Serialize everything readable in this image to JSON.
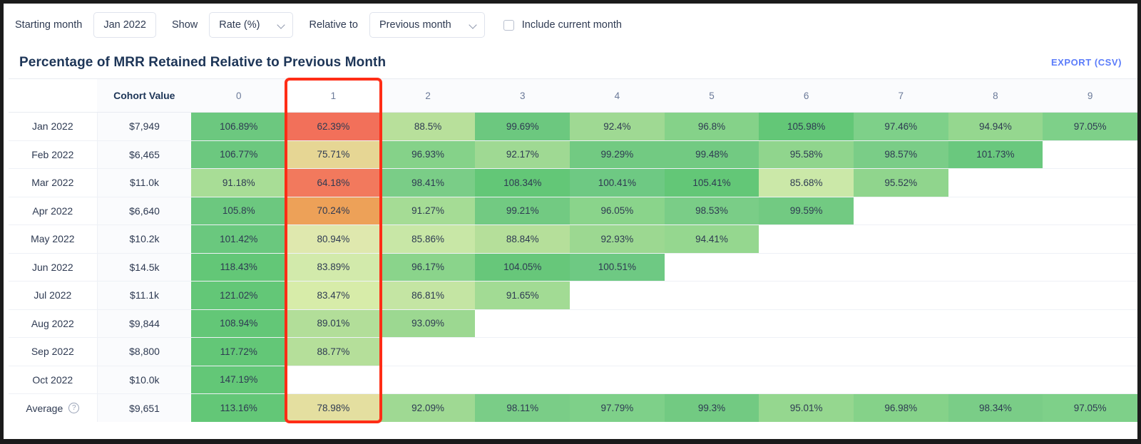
{
  "toolbar": {
    "starting_month_label": "Starting month",
    "starting_month_value": "Jan 2022",
    "show_label": "Show",
    "show_value": "Rate (%)",
    "relative_to_label": "Relative to",
    "relative_to_value": "Previous month",
    "include_current_month_label": "Include current month",
    "include_current_month_checked": false
  },
  "header": {
    "title": "Percentage of MRR Retained Relative to Previous Month",
    "export_label": "EXPORT (CSV)"
  },
  "colors": {
    "accent_link": "#5b7cfa",
    "title": "#1d3557",
    "highlight_box": "#ff2d16",
    "green_dark": "#63c777",
    "green_mid": "#7fd18b",
    "green_light": "#a8dd95",
    "green_pale": "#cbe8a8",
    "yellow": "#e4dfa0",
    "orange": "#eda158",
    "red": "#f2705a"
  },
  "table": {
    "label_header": "",
    "cohort_value_header": "Cohort Value",
    "period_headers": [
      "0",
      "1",
      "2",
      "3",
      "4",
      "5",
      "6",
      "7",
      "8",
      "9"
    ],
    "highlighted_column_index": 1,
    "average_row_label": "Average",
    "average_help_icon": "question-circle-icon",
    "rows": [
      {
        "label": "Jan 2022",
        "cohort_value": "$7,949",
        "cells": [
          {
            "text": "106.89%",
            "color": "#6cc87f"
          },
          {
            "text": "62.39%",
            "color": "#f2705a"
          },
          {
            "text": "88.5%",
            "color": "#b8e09b"
          },
          {
            "text": "99.69%",
            "color": "#6cc87f"
          },
          {
            "text": "92.4%",
            "color": "#9fd993"
          },
          {
            "text": "96.8%",
            "color": "#85d289"
          },
          {
            "text": "105.98%",
            "color": "#63c777"
          },
          {
            "text": "97.46%",
            "color": "#7ed089"
          },
          {
            "text": "94.94%",
            "color": "#95d78f"
          },
          {
            "text": "97.05%",
            "color": "#7ed089"
          }
        ]
      },
      {
        "label": "Feb 2022",
        "cohort_value": "$6,465",
        "cells": [
          {
            "text": "106.77%",
            "color": "#6cc87f"
          },
          {
            "text": "75.71%",
            "color": "#e6d694"
          },
          {
            "text": "96.93%",
            "color": "#85d289"
          },
          {
            "text": "92.17%",
            "color": "#9fd993"
          },
          {
            "text": "99.29%",
            "color": "#72ca82"
          },
          {
            "text": "99.48%",
            "color": "#72ca82"
          },
          {
            "text": "95.58%",
            "color": "#90d58d"
          },
          {
            "text": "98.57%",
            "color": "#7acd87"
          },
          {
            "text": "101.73%",
            "color": "#6ac87e"
          }
        ]
      },
      {
        "label": "Mar 2022",
        "cohort_value": "$11.0k",
        "cells": [
          {
            "text": "91.18%",
            "color": "#a8dd96"
          },
          {
            "text": "64.18%",
            "color": "#f2795d"
          },
          {
            "text": "98.41%",
            "color": "#7acd87"
          },
          {
            "text": "108.34%",
            "color": "#63c777"
          },
          {
            "text": "100.41%",
            "color": "#6ec983"
          },
          {
            "text": "105.41%",
            "color": "#63c777"
          },
          {
            "text": "85.68%",
            "color": "#cbe8a8"
          },
          {
            "text": "95.52%",
            "color": "#90d58d"
          }
        ]
      },
      {
        "label": "Apr 2022",
        "cohort_value": "$6,640",
        "cells": [
          {
            "text": "105.8%",
            "color": "#6cc87f"
          },
          {
            "text": "70.24%",
            "color": "#eda158"
          },
          {
            "text": "91.27%",
            "color": "#a5dc95"
          },
          {
            "text": "99.21%",
            "color": "#72ca82"
          },
          {
            "text": "96.05%",
            "color": "#8ad48b"
          },
          {
            "text": "98.53%",
            "color": "#7acd87"
          },
          {
            "text": "99.59%",
            "color": "#72ca82"
          }
        ]
      },
      {
        "label": "May 2022",
        "cohort_value": "$10.2k",
        "cells": [
          {
            "text": "101.42%",
            "color": "#6ac87e"
          },
          {
            "text": "80.94%",
            "color": "#dfe8ae"
          },
          {
            "text": "85.86%",
            "color": "#c8e7a6"
          },
          {
            "text": "88.84%",
            "color": "#b5df9a"
          },
          {
            "text": "92.93%",
            "color": "#9cd891"
          },
          {
            "text": "94.41%",
            "color": "#95d78f"
          }
        ]
      },
      {
        "label": "Jun 2022",
        "cohort_value": "$14.5k",
        "cells": [
          {
            "text": "118.43%",
            "color": "#63c777"
          },
          {
            "text": "83.89%",
            "color": "#d2eaab"
          },
          {
            "text": "96.17%",
            "color": "#8ad48b"
          },
          {
            "text": "104.05%",
            "color": "#67c77a"
          },
          {
            "text": "100.51%",
            "color": "#6ec983"
          }
        ]
      },
      {
        "label": "Jul 2022",
        "cohort_value": "$11.1k",
        "cells": [
          {
            "text": "121.02%",
            "color": "#63c777"
          },
          {
            "text": "83.47%",
            "color": "#d7eca9"
          },
          {
            "text": "86.81%",
            "color": "#c4e5a3"
          },
          {
            "text": "91.65%",
            "color": "#a2db94"
          }
        ]
      },
      {
        "label": "Aug 2022",
        "cohort_value": "$9,844",
        "cells": [
          {
            "text": "108.94%",
            "color": "#63c777"
          },
          {
            "text": "89.01%",
            "color": "#b2de99"
          },
          {
            "text": "93.09%",
            "color": "#9cd891"
          }
        ]
      },
      {
        "label": "Sep 2022",
        "cohort_value": "$8,800",
        "cells": [
          {
            "text": "117.72%",
            "color": "#63c777"
          },
          {
            "text": "88.77%",
            "color": "#b5df9a"
          }
        ]
      },
      {
        "label": "Oct 2022",
        "cohort_value": "$10.0k",
        "cells": [
          {
            "text": "147.19%",
            "color": "#63c777"
          }
        ]
      }
    ],
    "average_row": {
      "label": "Average",
      "cohort_value": "$9,651",
      "cells": [
        {
          "text": "113.16%",
          "color": "#63c777"
        },
        {
          "text": "78.98%",
          "color": "#e4dfa0"
        },
        {
          "text": "92.09%",
          "color": "#9fd993"
        },
        {
          "text": "98.11%",
          "color": "#7acd87"
        },
        {
          "text": "97.79%",
          "color": "#7ed089"
        },
        {
          "text": "99.3%",
          "color": "#72ca82"
        },
        {
          "text": "95.01%",
          "color": "#95d78f"
        },
        {
          "text": "96.98%",
          "color": "#85d289"
        },
        {
          "text": "98.34%",
          "color": "#7acd87"
        },
        {
          "text": "97.05%",
          "color": "#7ed089"
        }
      ]
    }
  }
}
